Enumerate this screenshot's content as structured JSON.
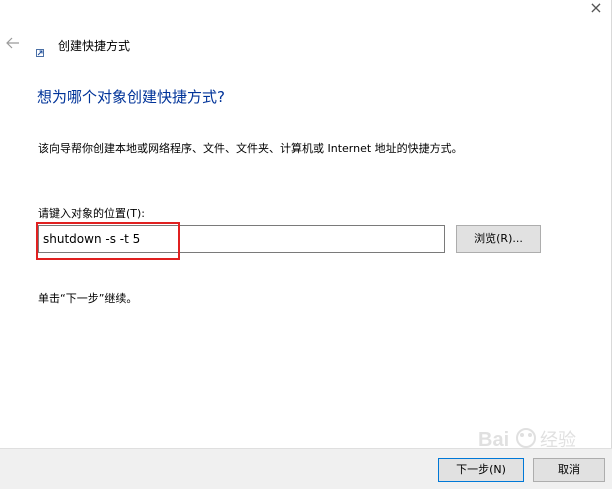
{
  "header": {
    "title": "创建快捷方式",
    "back_icon": "back-arrow-icon",
    "wizard_icon": "shortcut-wizard-icon"
  },
  "main": {
    "heading": "想为哪个对象创建快捷方式?",
    "description": "该向导帮你创建本地或网络程序、文件、文件夹、计算机或 Internet 地址的快捷方式。",
    "field_label": "请键入对象的位置(T):",
    "location_value": "shutdown -s -t 5",
    "browse_label": "浏览(R)...",
    "hint": "单击“下一步”继续。"
  },
  "footer": {
    "next_label": "下一步(N)",
    "cancel_label": "取消"
  },
  "colors": {
    "heading": "#003399",
    "highlight": "#e02020",
    "default_button_border": "#0078d7"
  },
  "watermark": {
    "text": "Baidu 经验"
  }
}
